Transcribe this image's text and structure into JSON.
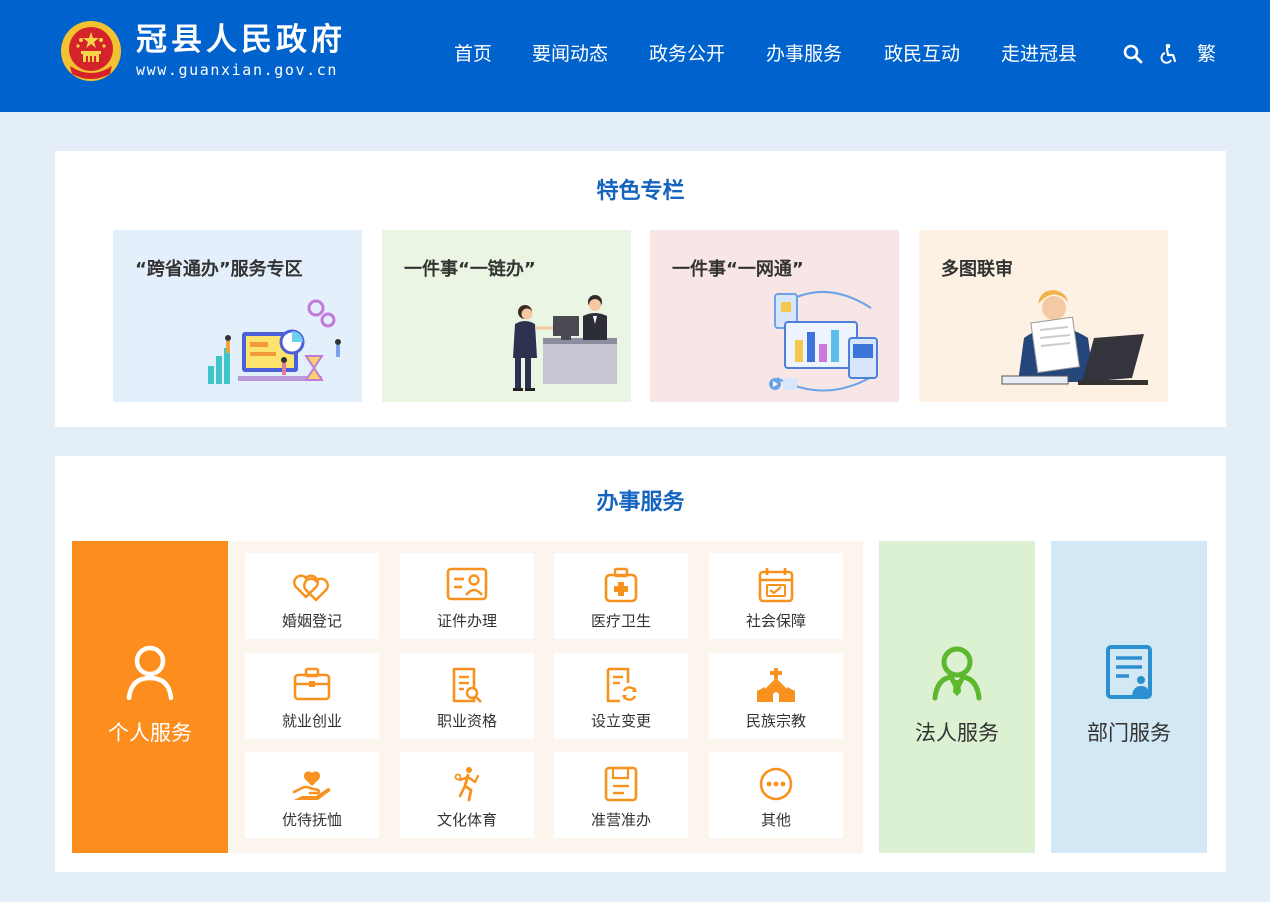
{
  "header": {
    "site_name": "冠县人民政府",
    "site_url": "www.guanxian.gov.cn",
    "nav": [
      "首页",
      "要闻动态",
      "政务公开",
      "办事服务",
      "政民互动",
      "走进冠县"
    ],
    "tools": {
      "search": "search-icon",
      "accessibility": "accessibility-icon",
      "traditional_label": "繁"
    }
  },
  "featured": {
    "title": "特色专栏",
    "cards": [
      {
        "title": "“跨省通办”服务专区",
        "bg": "#e3f0fb"
      },
      {
        "title": "一件事“一链办”",
        "bg": "#eaf6e3"
      },
      {
        "title": "一件事“一网通”",
        "bg": "#f8e6e6"
      },
      {
        "title": "多图联审",
        "bg": "#fdf1e4"
      }
    ]
  },
  "services": {
    "title": "办事服务",
    "personal": {
      "label": "个人服务",
      "bg": "#fd8e1e"
    },
    "legal": {
      "label": "法人服务",
      "bg": "#dcf0d2"
    },
    "department": {
      "label": "部门服务",
      "bg": "#d3e8f5"
    },
    "items": [
      "婚姻登记",
      "证件办理",
      "医疗卫生",
      "社会保障",
      "就业创业",
      "职业资格",
      "设立变更",
      "民族宗教",
      "优待抚恤",
      "文化体育",
      "准营准办",
      "其他"
    ],
    "icon_color": "#f7921e"
  },
  "colors": {
    "header_bg": "#0062cc",
    "page_bg": "#e3eef9",
    "title_blue": "#1565c0"
  }
}
